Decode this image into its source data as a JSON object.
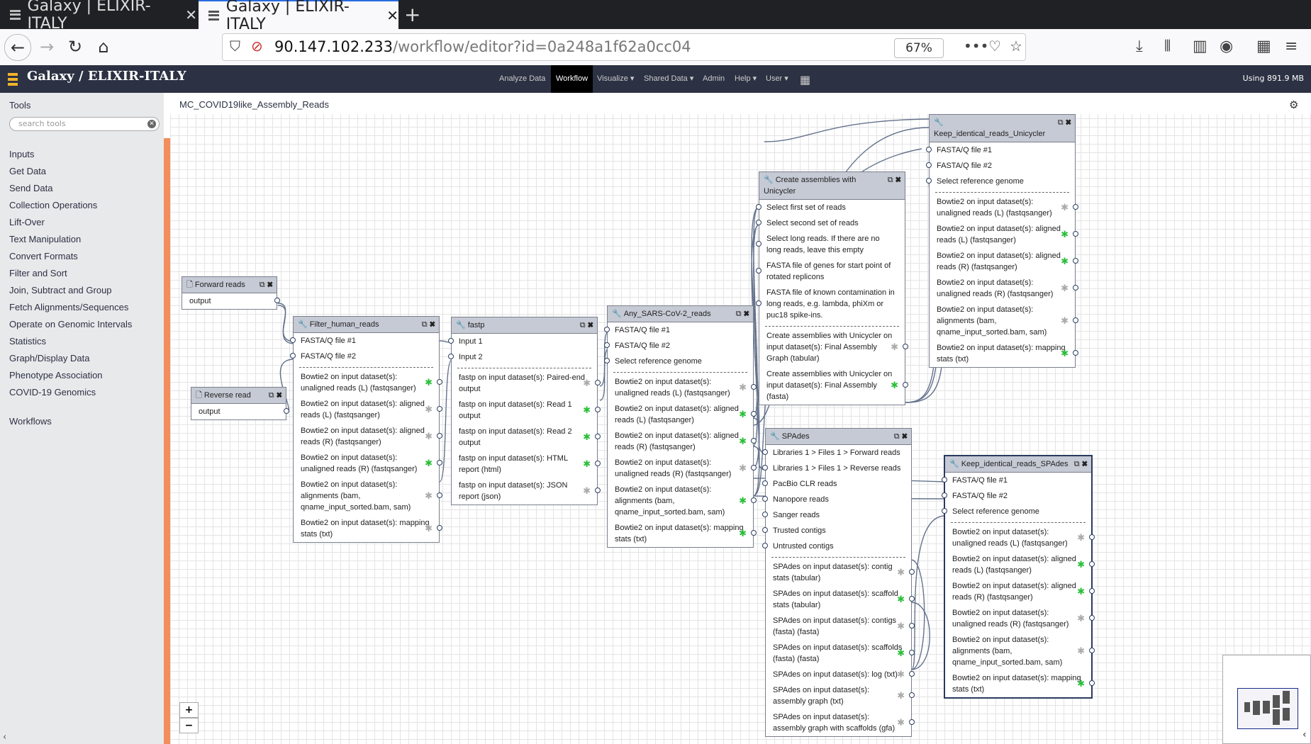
{
  "browser": {
    "tabs": [
      {
        "title": "Galaxy | ELIXIR-ITALY",
        "active": false
      },
      {
        "title": "Galaxy | ELIXIR-ITALY",
        "active": true
      }
    ],
    "url_host": "90.147.102.233",
    "url_path": "/workflow/editor?id=0a248a1f62a0cc04",
    "zoom": "67%"
  },
  "masthead": {
    "brand": "Galaxy / ELIXIR-ITALY",
    "nav": [
      "Analyze Data",
      "Workflow",
      "Visualize",
      "Shared Data",
      "Admin",
      "Help",
      "User"
    ],
    "quota": "Using 891.9 MB"
  },
  "tool_panel": {
    "title": "Tools",
    "search_placeholder": "search tools",
    "sections": [
      "Inputs",
      "Get Data",
      "Send Data",
      "Collection Operations",
      "Lift-Over",
      "Text Manipulation",
      "Convert Formats",
      "Filter and Sort",
      "Join, Subtract and Group",
      "Fetch Alignments/Sequences",
      "Operate on Genomic Intervals",
      "Statistics",
      "Graph/Display Data",
      "Phenotype Association",
      "COVID-19 Genomics"
    ],
    "workflows": "Workflows"
  },
  "workflow": {
    "title": "MC_COVID19like_Assembly_Reads"
  },
  "nodes": {
    "forward": {
      "title": "Forward reads",
      "outputs": [
        "output"
      ]
    },
    "reverse": {
      "title": "Reverse read",
      "outputs": [
        "output"
      ]
    },
    "filter": {
      "title": "Filter_human_reads",
      "inputs": [
        "FASTA/Q file #1",
        "FASTA/Q file #2"
      ],
      "outputs": [
        "Bowtie2 on input dataset(s): unaligned reads (L) (fastqsanger)",
        "Bowtie2 on input dataset(s): aligned reads (L) (fastqsanger)",
        "Bowtie2 on input dataset(s): aligned reads (R) (fastqsanger)",
        "Bowtie2 on input dataset(s): unaligned reads (R) (fastqsanger)",
        "Bowtie2 on input dataset(s): alignments (bam, qname_input_sorted.bam, sam)",
        "Bowtie2 on input dataset(s): mapping stats (txt)"
      ]
    },
    "fastp": {
      "title": "fastp",
      "inputs": [
        "Input 1",
        "Input 2"
      ],
      "outputs": [
        "fastp on input dataset(s): Paired-end output",
        "fastp on input dataset(s): Read 1 output",
        "fastp on input dataset(s): Read 2 output",
        "fastp on input dataset(s): HTML report (html)",
        "fastp on input dataset(s): JSON report (json)"
      ]
    },
    "sars": {
      "title": "Any_SARS-CoV-2_reads",
      "inputs": [
        "FASTA/Q file #1",
        "FASTA/Q file #2",
        "Select reference genome"
      ],
      "outputs": [
        "Bowtie2 on input dataset(s): unaligned reads (L) (fastqsanger)",
        "Bowtie2 on input dataset(s): aligned reads (L) (fastqsanger)",
        "Bowtie2 on input dataset(s): aligned reads (R) (fastqsanger)",
        "Bowtie2 on input dataset(s): unaligned reads (R) (fastqsanger)",
        "Bowtie2 on input dataset(s): alignments (bam, qname_input_sorted.bam, sam)",
        "Bowtie2 on input dataset(s): mapping stats (txt)"
      ]
    },
    "unicycler": {
      "title": "Create assemblies with Unicycler",
      "inputs": [
        "Select first set of reads",
        "Select second set of reads",
        "Select long reads. If there are no long reads, leave this empty",
        "FASTA file of genes for start point of rotated replicons",
        "FASTA file of known contamination in long reads, e.g. lambda, phiXm or puc18 spike-ins."
      ],
      "outputs": [
        "Create assemblies with Unicycler on input dataset(s): Final Assembly Graph (tabular)",
        "Create assemblies with Unicycler on input dataset(s): Final Assembly (fasta)"
      ]
    },
    "keep_uni": {
      "title": "Keep_identical_reads_Unicycler",
      "inputs": [
        "FASTA/Q file #1",
        "FASTA/Q file #2",
        "Select reference genome"
      ],
      "outputs": [
        "Bowtie2 on input dataset(s): unaligned reads (L) (fastqsanger)",
        "Bowtie2 on input dataset(s): aligned reads (L) (fastqsanger)",
        "Bowtie2 on input dataset(s): aligned reads (R) (fastqsanger)",
        "Bowtie2 on input dataset(s): unaligned reads (R) (fastqsanger)",
        "Bowtie2 on input dataset(s): alignments (bam, qname_input_sorted.bam, sam)",
        "Bowtie2 on input dataset(s): mapping stats (txt)"
      ]
    },
    "spades": {
      "title": "SPAdes",
      "inputs": [
        "Libraries 1 > Files 1 > Forward reads",
        "Libraries 1 > Files 1 > Reverse reads",
        "PacBio CLR reads",
        "Nanopore reads",
        "Sanger reads",
        "Trusted contigs",
        "Untrusted contigs"
      ],
      "outputs": [
        "SPAdes on input dataset(s): contig stats (tabular)",
        "SPAdes on input dataset(s): scaffold stats (tabular)",
        "SPAdes on input dataset(s): contigs (fasta) (fasta)",
        "SPAdes on input dataset(s): scaffolds (fasta) (fasta)",
        "SPAdes on input dataset(s): log (txt)",
        "SPAdes on input dataset(s): assembly graph (txt)",
        "SPAdes on input dataset(s): assembly graph with scaffolds (gfa)"
      ]
    },
    "keep_spades": {
      "title": "Keep_identical_reads_SPAdes",
      "inputs": [
        "FASTA/Q file #1",
        "FASTA/Q file #2",
        "Select reference genome"
      ],
      "outputs": [
        "Bowtie2 on input dataset(s): unaligned reads (L) (fastqsanger)",
        "Bowtie2 on input dataset(s): aligned reads (L) (fastqsanger)",
        "Bowtie2 on input dataset(s): aligned reads (R) (fastqsanger)",
        "Bowtie2 on input dataset(s): unaligned reads (R) (fastqsanger)",
        "Bowtie2 on input dataset(s): alignments (bam, qname_input_sorted.bam, sam)",
        "Bowtie2 on input dataset(s): mapping stats (txt)"
      ]
    }
  },
  "zoom_controls": {
    "in": "+",
    "out": "−"
  }
}
